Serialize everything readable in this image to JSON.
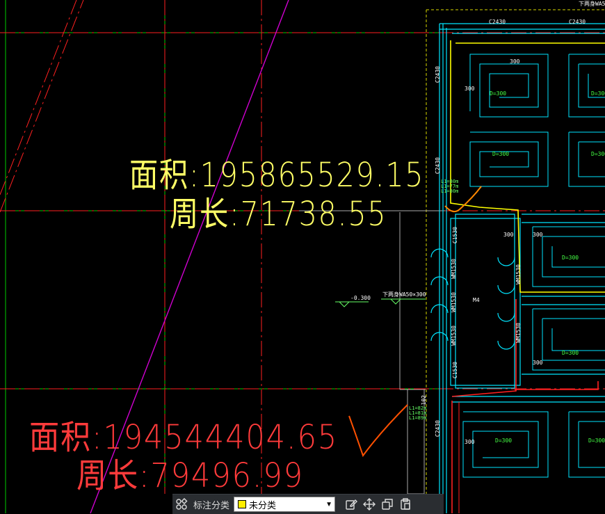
{
  "annotations": {
    "area_1": "面积:195865529.15",
    "perimeter_1": "周长:71738.55",
    "area_2": "面积:194544404.65",
    "perimeter_2": "周长:79496.99"
  },
  "colors": {
    "annotation_1": "#ffff66",
    "annotation_2": "#ff3b3b",
    "grid_green": "#00cc00",
    "axis_red": "#ff2020",
    "wall_cyan": "#00e5ff",
    "magenta": "#d000d0"
  },
  "cad_labels": {
    "window_c2430_a": "C2430",
    "window_c2430_b": "C2430",
    "window_c2430_side_1": "C2430",
    "window_c2430_side_2": "C2430",
    "window_c2430_side_3": "C2430",
    "window_c1530_a": "C1530",
    "window_c1530_b": "C1530",
    "window_wm_1": "WM1530",
    "window_wm_2": "WM1530",
    "window_wm_3": "WM1530",
    "window_wm_4": "WM1530",
    "window_wm_5": "WM1530",
    "dim_300_1": "300",
    "dim_300_2": "300",
    "dim_300_3": "300",
    "dim_300_4": "300",
    "dim_300_5": "300",
    "dim_300_6": "300",
    "pipe_d300_1": "D=300",
    "pipe_d300_2": "D=300",
    "pipe_d300_3": "D=300",
    "pipe_d300_4": "D=300",
    "pipe_d300_5": "D=300",
    "pipe_d300_6": "D=300",
    "pipe_d300_7": "D=300",
    "pipe_d300_8": "D=300",
    "elev": "-0.300",
    "drain_text": "下两身WA50×300",
    "room_tag": "M4",
    "top_right_text": "下两身WA50",
    "len_top": "L1=80m\nL1=77m\nL1=80m",
    "len_bottom": "L1=82m\nL1=81m\nL1=89m",
    "riser_102": "102"
  },
  "toolbar": {
    "category_label": "标注分类",
    "category_value": "未分类",
    "category_color": "#ffee00",
    "icons": [
      "grid-icon",
      "edit-icon",
      "move-icon",
      "copy-icon",
      "paste-icon"
    ]
  }
}
